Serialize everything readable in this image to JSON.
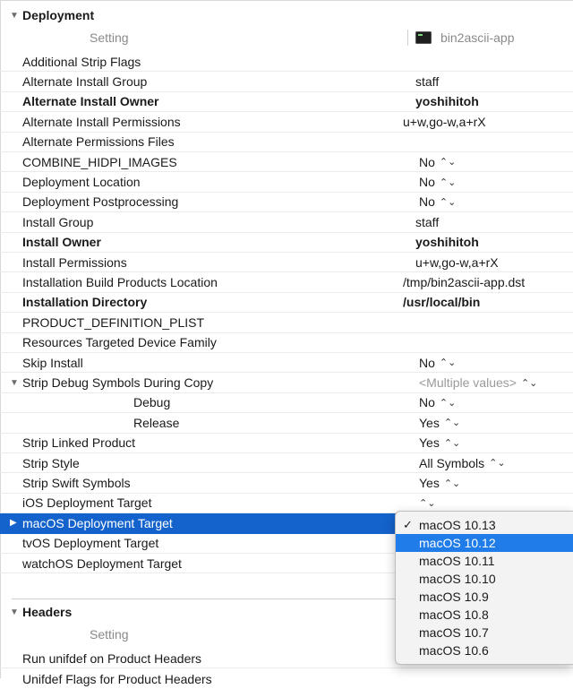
{
  "deployment": {
    "title": "Deployment",
    "setting_col": "Setting",
    "target_col": "bin2ascii-app",
    "rows": [
      {
        "name": "Additional Strip Flags",
        "value": ""
      },
      {
        "name": "Alternate Install Group",
        "value": "staff"
      },
      {
        "name": "Alternate Install Owner",
        "value": "yoshihitoh"
      },
      {
        "name": "Alternate Install Permissions",
        "value": "u+w,go-w,a+rX"
      },
      {
        "name": "Alternate Permissions Files",
        "value": ""
      },
      {
        "name": "COMBINE_HIDPI_IMAGES",
        "value": "No"
      },
      {
        "name": "Deployment Location",
        "value": "No"
      },
      {
        "name": "Deployment Postprocessing",
        "value": "No"
      },
      {
        "name": "Install Group",
        "value": "staff"
      },
      {
        "name": "Install Owner",
        "value": "yoshihitoh"
      },
      {
        "name": "Install Permissions",
        "value": "u+w,go-w,a+rX"
      },
      {
        "name": "Installation Build Products Location",
        "value": "/tmp/bin2ascii-app.dst"
      },
      {
        "name": "Installation Directory",
        "value": "/usr/local/bin"
      },
      {
        "name": "PRODUCT_DEFINITION_PLIST",
        "value": ""
      },
      {
        "name": "Resources Targeted Device Family",
        "value": ""
      },
      {
        "name": "Skip Install",
        "value": "No"
      },
      {
        "name": "Strip Debug Symbols During Copy",
        "value": "<Multiple values>"
      },
      {
        "name": "Debug",
        "value": "No"
      },
      {
        "name": "Release",
        "value": "Yes"
      },
      {
        "name": "Strip Linked Product",
        "value": "Yes"
      },
      {
        "name": "Strip Style",
        "value": "All Symbols"
      },
      {
        "name": "Strip Swift Symbols",
        "value": "Yes"
      },
      {
        "name": "iOS Deployment Target",
        "value": ""
      },
      {
        "name": "macOS Deployment Target",
        "value": ""
      },
      {
        "name": "tvOS Deployment Target",
        "value": ""
      },
      {
        "name": "watchOS Deployment Target",
        "value": ""
      }
    ]
  },
  "headers": {
    "title": "Headers",
    "setting_col": "Setting",
    "rows": [
      {
        "name": "Run unifdef on Product Headers",
        "value": ""
      },
      {
        "name": "Unifdef Flags for Product Headers",
        "value": ""
      }
    ]
  },
  "icons": {
    "disclosure_open": "▼",
    "disclosure_closed": "▶",
    "stepper": "⌃⌄",
    "check": "✓"
  },
  "popup": {
    "items": [
      "macOS 10.13",
      "macOS 10.12",
      "macOS 10.11",
      "macOS 10.10",
      "macOS 10.9",
      "macOS 10.8",
      "macOS 10.7",
      "macOS 10.6"
    ],
    "checked": "macOS 10.13",
    "highlighted": "macOS 10.12"
  },
  "colors": {
    "selection": "#1463cc",
    "menu_highlight": "#1f7ce8"
  }
}
